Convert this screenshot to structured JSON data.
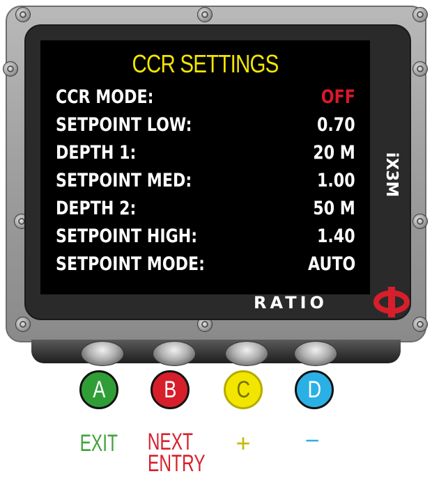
{
  "screen": {
    "title": "CCR SETTINGS",
    "rows": [
      {
        "label": "CCR MODE:",
        "value": "OFF"
      },
      {
        "label": "SETPOINT LOW:",
        "value": "0.70"
      },
      {
        "label": "DEPTH 1:",
        "value": "20 M"
      },
      {
        "label": "SETPOINT MED:",
        "value": "1.00"
      },
      {
        "label": "DEPTH 2:",
        "value": "50 M"
      },
      {
        "label": "SETPOINT HIGH:",
        "value": "1.40"
      },
      {
        "label": "SETPOINT MODE:",
        "value": "AUTO"
      }
    ],
    "off_color": "#d8182a",
    "title_color": "#f2e600"
  },
  "device": {
    "model": "iX3M",
    "brand": "RATIO",
    "logo_icon": "phi-logo-icon"
  },
  "buttons": {
    "a": {
      "letter": "A",
      "caption": "EXIT",
      "color": "#2f9e36"
    },
    "b": {
      "letter": "B",
      "caption_line1": "NEXT",
      "caption_line2": "ENTRY",
      "color": "#d61f2b"
    },
    "c": {
      "letter": "C",
      "caption": "+",
      "color": "#f2e600"
    },
    "d": {
      "letter": "D",
      "caption": "−",
      "color": "#2bb0e6"
    }
  }
}
